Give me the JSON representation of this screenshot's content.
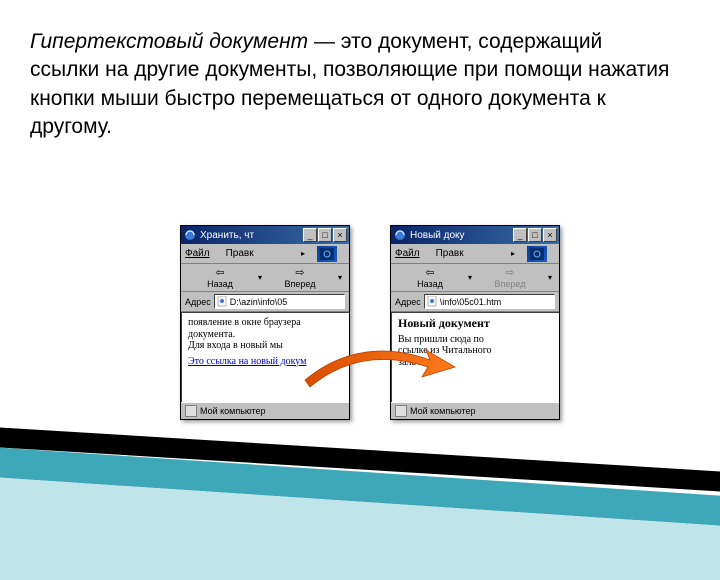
{
  "definition": {
    "term": "Гипертекстовый документ",
    "rest": " — это документ, содержащий ссылки на другие документы, позволяющие при помощи нажатия кнопки мыши быстро перемещаться от одного документа к другому."
  },
  "window1": {
    "title": "Хранить, чт",
    "menu_file": "Файл",
    "menu_edit": "Правк",
    "nav_back": "Назад",
    "nav_forward": "Вперед",
    "addr_label": "Адрес",
    "addr_value": "D:\\azin\\info\\05",
    "content_line1": "появление в окне браузера",
    "content_line2": "документа.",
    "content_line3": "Для входа в новый         мы",
    "content_link": "Это ссылка на новый докум",
    "status": "Мой компьютер"
  },
  "window2": {
    "title": "Новый доку",
    "menu_file": "Файл",
    "menu_edit": "Правк",
    "nav_back": "Назад",
    "nav_forward": "Вперед",
    "addr_label": "Адрес",
    "addr_value": "\\info\\05с01.htm",
    "heading": "Новый документ",
    "content_line1": "Вы пришли сюда по",
    "content_line2": "ссылке из Читального",
    "content_line3": "зала книги.",
    "status": "Мой компьютер"
  },
  "icons": {
    "minimize": "_",
    "maximize": "□",
    "close": "×",
    "menu_expand": "▸",
    "nav_dropdown": "▾",
    "back_arrow": "⇦",
    "forward_arrow": "⇨"
  }
}
